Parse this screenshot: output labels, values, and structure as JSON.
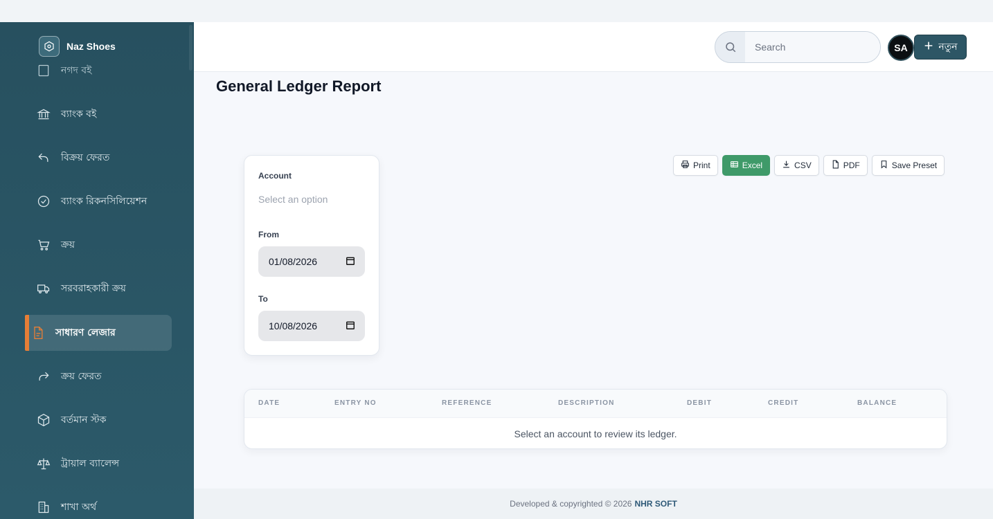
{
  "brand": {
    "name": "Naz Shoes"
  },
  "sidebar": {
    "items": [
      {
        "label": "নগদ বই",
        "icon": "book-icon",
        "active": false,
        "partial": true
      },
      {
        "label": "ব্যাংক বই",
        "icon": "bank-icon",
        "active": false
      },
      {
        "label": "বিক্রয় ফেরত",
        "icon": "return-arrow-icon",
        "active": false
      },
      {
        "label": "ব্যাংক রিকনসিলিয়েশন",
        "icon": "check-circle-icon",
        "active": false
      },
      {
        "label": "ক্রয়",
        "icon": "cart-icon",
        "active": false
      },
      {
        "label": "সরবরাহকারী ক্রয়",
        "icon": "truck-icon",
        "active": false
      },
      {
        "label": "সাধারণ লেজার",
        "icon": "document-icon",
        "active": true
      },
      {
        "label": "ক্রয় ফেরত",
        "icon": "forward-arrow-icon",
        "active": false
      },
      {
        "label": "বর্তমান স্টক",
        "icon": "box-icon",
        "active": false
      },
      {
        "label": "ট্রায়াল ব্যালেন্স",
        "icon": "scale-icon",
        "active": false
      },
      {
        "label": "শাখা অর্থ",
        "icon": "building-icon",
        "active": false
      }
    ]
  },
  "header": {
    "search_placeholder": "Search",
    "avatar_initials": "SA",
    "new_button_label": "নতুন"
  },
  "page": {
    "title": "General Ledger Report"
  },
  "filters": {
    "account_label": "Account",
    "account_placeholder": "Select an option",
    "from_label": "From",
    "from_value": "01/08/2026",
    "to_label": "To",
    "to_value": "10/08/2026"
  },
  "toolbar": {
    "print": "Print",
    "excel": "Excel",
    "csv": "CSV",
    "pdf": "PDF",
    "save_preset": "Save Preset"
  },
  "table": {
    "columns": [
      "DATE",
      "ENTRY NO",
      "REFERENCE",
      "DESCRIPTION",
      "DEBIT",
      "CREDIT",
      "BALANCE"
    ],
    "empty_message": "Select an account to review its ledger."
  },
  "footer": {
    "text": "Developed & copyrighted © 2026",
    "company": "NHR SOFT"
  },
  "colors": {
    "sidebar": "#27505f",
    "accent": "#e67e36",
    "excel": "#3f9a69",
    "primary_button": "#2d5665"
  }
}
